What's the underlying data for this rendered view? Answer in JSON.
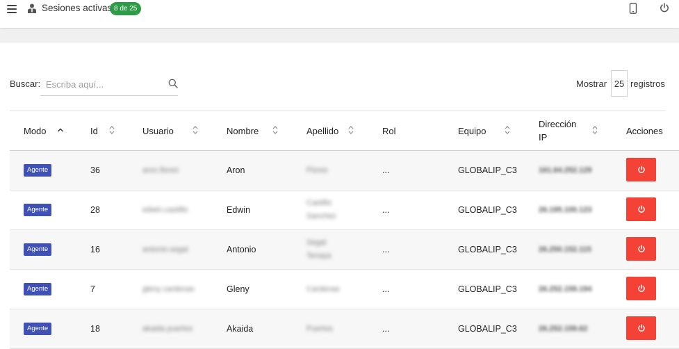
{
  "topbar": {
    "menu_icon": "hamburger-menu-icon",
    "user_icon": "user-icon",
    "title": "Sesiones activas",
    "badge": "8 de 25",
    "badge_color": "#2e9c46",
    "phone_icon": "mobile-phone-icon",
    "power_icon": "power-icon"
  },
  "search": {
    "label": "Buscar:",
    "placeholder": "Escriba aquí...",
    "value": "",
    "icon": "search-icon"
  },
  "paging": {
    "show_label": "Mostrar",
    "value": "25",
    "suffix": "registros"
  },
  "table": {
    "columns": [
      {
        "label": "Modo",
        "sort": "asc"
      },
      {
        "label": "Id",
        "sort": "both"
      },
      {
        "label": "Usuario",
        "sort": "both"
      },
      {
        "label": "Nombre",
        "sort": "both"
      },
      {
        "label": "Apellido",
        "sort": "both"
      },
      {
        "label": "Rol",
        "sort": "none"
      },
      {
        "label": "Equipo",
        "sort": "both"
      },
      {
        "label": "Dirección IP",
        "sort": "both"
      },
      {
        "label": "Acciones",
        "sort": "none"
      }
    ],
    "rows": [
      {
        "modo": "Agente",
        "id": "36",
        "usuario": "aron.flores",
        "nombre": "Aron",
        "apellido": "Flores",
        "rol": "...",
        "equipo": "GLOBALIP_C3",
        "ip": "161.64.252.129"
      },
      {
        "modo": "Agente",
        "id": "28",
        "usuario": "edwin.castillo",
        "nombre": "Edwin",
        "apellido": "Castillo Sanchez",
        "rol": "...",
        "equipo": "GLOBALIP_C3",
        "ip": "26.195.100.123"
      },
      {
        "modo": "Agente",
        "id": "16",
        "usuario": "antonio.segal",
        "nombre": "Antonio",
        "apellido": "Segal Tenaya",
        "rol": "...",
        "equipo": "GLOBALIP_C3",
        "ip": "26.250.152.115"
      },
      {
        "modo": "Agente",
        "id": "7",
        "usuario": "gleny cardenas",
        "nombre": "Gleny",
        "apellido": "Cardenas",
        "rol": "...",
        "equipo": "GLOBALIP_C3",
        "ip": "26.252.159.194"
      },
      {
        "modo": "Agente",
        "id": "18",
        "usuario": "akaida puertos",
        "nombre": "Akaida",
        "apellido": "Puertos",
        "rol": "...",
        "equipo": "GLOBALIP_C3",
        "ip": "26.252.159.62"
      }
    ],
    "action_icon": "power-icon",
    "action_color": "#f44336",
    "mode_badge_color": "#3f51b5"
  }
}
